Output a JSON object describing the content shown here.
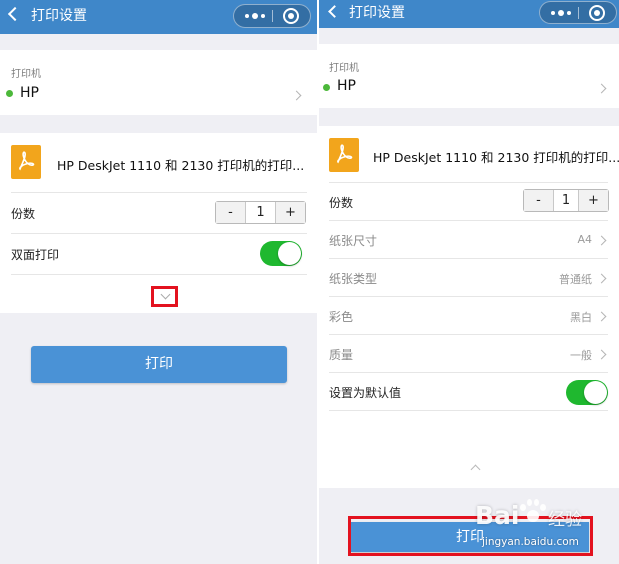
{
  "colors": {
    "navbar": "#3f87c9",
    "primary_button": "#4a92d6",
    "toggle_on": "#1fb82f",
    "status_online": "#4cb83a",
    "highlight_box": "#e3121f",
    "pdf_icon": "#f2a51c"
  },
  "left": {
    "header": {
      "title": "打印设置",
      "back_icon": "chevron-left-icon",
      "more_icon": "more-dots-icon",
      "close_icon": "target-circle-icon"
    },
    "printer": {
      "section_label": "打印机",
      "name": "HP",
      "status": "online"
    },
    "document": {
      "icon": "pdf-icon",
      "title": "HP DeskJet 1110 和 2130 打印机的打印..."
    },
    "copies": {
      "label": "份数",
      "minus": "-",
      "value": "1",
      "plus": "+"
    },
    "duplex": {
      "label": "双面打印",
      "on": true
    },
    "expand_icon": "chevron-down-icon",
    "print_button": "打印"
  },
  "right": {
    "header": {
      "title": "打印设置",
      "back_icon": "chevron-left-icon",
      "more_icon": "more-dots-icon",
      "close_icon": "target-circle-icon"
    },
    "printer": {
      "section_label": "打印机",
      "name": "HP",
      "status": "online"
    },
    "document": {
      "icon": "pdf-icon",
      "title": "HP DeskJet 1110 和 2130 打印机的打印..."
    },
    "copies": {
      "label": "份数",
      "minus": "-",
      "value": "1",
      "plus": "+"
    },
    "paper_size": {
      "label": "纸张尺寸",
      "value": "A4"
    },
    "paper_type": {
      "label": "纸张类型",
      "value": "普通纸"
    },
    "color": {
      "label": "彩色",
      "value": "黑白"
    },
    "quality": {
      "label": "质量",
      "value": "一般"
    },
    "default": {
      "label": "设置为默认值",
      "on": true
    },
    "collapse_icon": "chevron-up-icon",
    "print_button": "打印"
  },
  "watermark": {
    "brand": "Bai",
    "brand_cn": "经验",
    "url": "jingyan.baidu.com"
  }
}
